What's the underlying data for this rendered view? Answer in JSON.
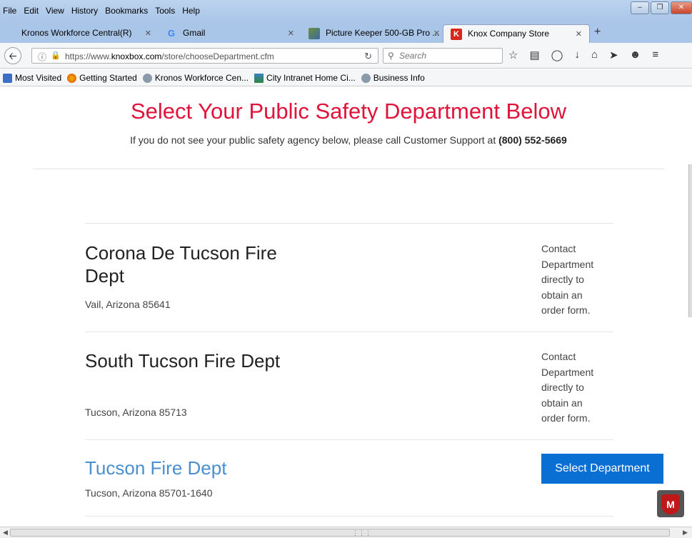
{
  "menu": [
    "File",
    "Edit",
    "View",
    "History",
    "Bookmarks",
    "Tools",
    "Help"
  ],
  "tabs": [
    {
      "label": "Kronos Workforce Central(R)",
      "icon": "none"
    },
    {
      "label": "Gmail",
      "icon": "gmail-icon"
    },
    {
      "label": "Picture Keeper 500-GB Pro ...",
      "icon": "picture-keeper-icon"
    },
    {
      "label": "Knox Company Store",
      "icon": "knox-icon"
    }
  ],
  "nav": {
    "url": "https://www.knoxbox.com/store/chooseDepartment.cfm",
    "url_prefix": "https://www.",
    "url_domain": "knoxbox.com",
    "url_path": "/store/chooseDepartment.cfm",
    "search_placeholder": "Search"
  },
  "bookmarks": [
    {
      "label": "Most Visited"
    },
    {
      "label": "Getting Started"
    },
    {
      "label": "Kronos Workforce Cen..."
    },
    {
      "label": "City Intranet Home  Ci..."
    },
    {
      "label": "Business Info"
    }
  ],
  "page": {
    "title": "Select Your Public Safety Department Below",
    "subtitle": "If you do not see your public safety agency below, please call Customer Support at ",
    "phone": "(800) 552-5669",
    "departments": [
      {
        "name": "Corona De Tucson Fire Dept",
        "location": "Vail, Arizona 85641",
        "action": "Contact Department directly to obtain an order form."
      },
      {
        "name": "South Tucson Fire Dept",
        "location": "Tucson, Arizona 85713",
        "action": "Contact Department directly to obtain an order form."
      },
      {
        "name": "Tucson Fire Dept",
        "location": "Tucson, Arizona 85701-1640",
        "action": "Select Department"
      }
    ]
  },
  "colors": {
    "title": "#e0133a",
    "link": "#4a8fd0",
    "button": "#0a6fd2"
  }
}
